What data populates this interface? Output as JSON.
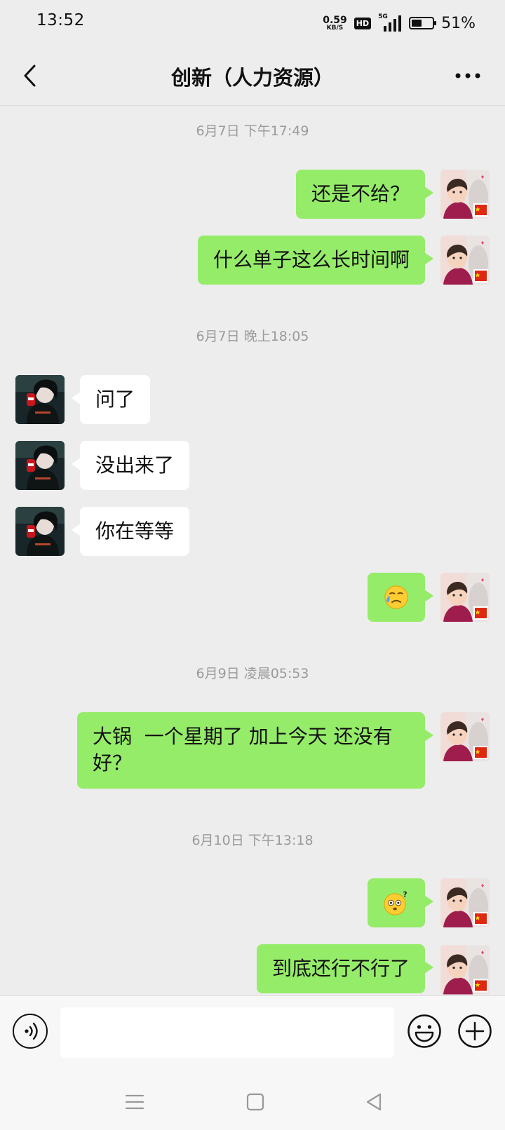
{
  "status_bar": {
    "time": "13:52",
    "net_speed_value": "0.59",
    "net_speed_unit": "KB/S",
    "hd_label": "HD",
    "signal_label": "5G",
    "battery_percent": "51%",
    "battery_level": 0.51
  },
  "header": {
    "title": "创新（人力资源）",
    "back_icon": "chevron-left-icon",
    "more_icon": "more-dots-icon"
  },
  "messages": {
    "ts1": "6月7日 下午17:49",
    "m1": "还是不给？",
    "m2": "什么单子这么长时间啊",
    "ts2": "6月7日 晚上18:05",
    "m3": "问了",
    "m4": "没出来了",
    "m5": "你在等等",
    "m6_emoji": "😥",
    "ts3": "6月9日 凌晨05:53",
    "m7": "大锅  一个星期了 加上今天 还没有\n好？",
    "ts4": "6月10日 下午13:18",
    "m8_emoji": "😳",
    "m9": "到底还行不行了"
  },
  "input_bar": {
    "value": "",
    "voice_icon": "voice-icon",
    "emoji_icon": "emoji-icon",
    "plus_icon": "plus-icon"
  },
  "nav_bar": {
    "menu_icon": "menu-icon",
    "home_icon": "home-square-icon",
    "back_icon": "back-triangle-icon"
  },
  "colors": {
    "sent_bubble": "#95ec69",
    "received_bubble": "#ffffff",
    "background": "#ededed"
  }
}
